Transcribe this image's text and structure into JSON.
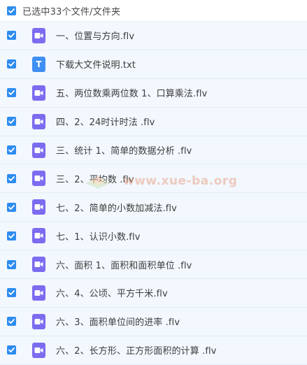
{
  "header": {
    "label": "已选中33个文件/文件夹",
    "checked": true
  },
  "colors": {
    "checkbox": "#2e8cf0",
    "video_icon": "#7b6cf0",
    "text_icon": "#3f8ff2",
    "row_background": "#f3f8fe",
    "watermark_text": "#e8a48a"
  },
  "files": [
    {
      "name": "一、位置与方向.flv",
      "type": "video",
      "icon": "video-file-icon",
      "checked": true
    },
    {
      "name": "下载大文件说明.txt",
      "type": "text",
      "icon": "text-file-icon",
      "glyph": "T",
      "checked": true
    },
    {
      "name": "五、两位数乘两位数 1、口算乘法.flv",
      "type": "video",
      "icon": "video-file-icon",
      "checked": true
    },
    {
      "name": "四、2、24时计时法 .flv",
      "type": "video",
      "icon": "video-file-icon",
      "checked": true
    },
    {
      "name": "三、统计 1、简单的数据分析 .flv",
      "type": "video",
      "icon": "video-file-icon",
      "checked": true
    },
    {
      "name": "三、2、平均数 .flv",
      "type": "video",
      "icon": "video-file-icon",
      "checked": true
    },
    {
      "name": "七、2、简单的小数加减法.flv",
      "type": "video",
      "icon": "video-file-icon",
      "checked": true
    },
    {
      "name": "七、1、认识小数.flv",
      "type": "video",
      "icon": "video-file-icon",
      "checked": true
    },
    {
      "name": "六、面积 1、面积和面积单位 .flv",
      "type": "video",
      "icon": "video-file-icon",
      "checked": true
    },
    {
      "name": "六、4、公顷、平方千米.flv",
      "type": "video",
      "icon": "video-file-icon",
      "checked": true
    },
    {
      "name": "六、3、面积单位间的进率 .flv",
      "type": "video",
      "icon": "video-file-icon",
      "checked": true
    },
    {
      "name": "六、2、长方形、正方形面积的计算 .flv",
      "type": "video",
      "icon": "video-file-icon",
      "checked": true
    }
  ],
  "watermark": {
    "text": "www.xue-ba.org",
    "icon": "book-logo-icon"
  }
}
